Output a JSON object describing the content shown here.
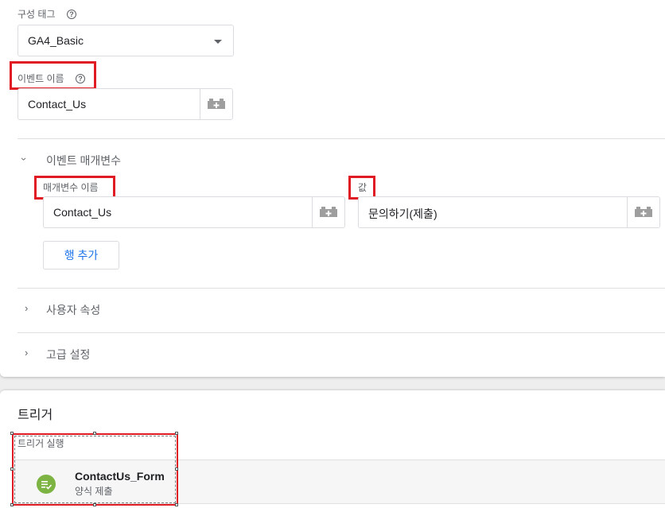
{
  "config_tag": {
    "label": "구성 태그",
    "help": "?",
    "selected": "GA4_Basic"
  },
  "event_name": {
    "label": "이벤트 이름",
    "help": "?",
    "value": "Contact_Us"
  },
  "event_params": {
    "title": "이벤트 매개변수",
    "col_name_label": "매개변수 이름",
    "col_value_label": "값",
    "rows": [
      {
        "name": "Contact_Us",
        "value": "문의하기(제출)"
      }
    ],
    "add_row_label": "행 추가"
  },
  "user_props": {
    "title": "사용자 속성"
  },
  "advanced": {
    "title": "고급 설정"
  },
  "triggers": {
    "heading": "트리거",
    "fire_label": "트리거 실행",
    "items": [
      {
        "name": "ContactUs_Form",
        "type": "양식 제출",
        "color": "#7cb342"
      }
    ]
  },
  "colors": {
    "accent_blue": "#1a73e8",
    "highlight_red": "#e01b24"
  }
}
